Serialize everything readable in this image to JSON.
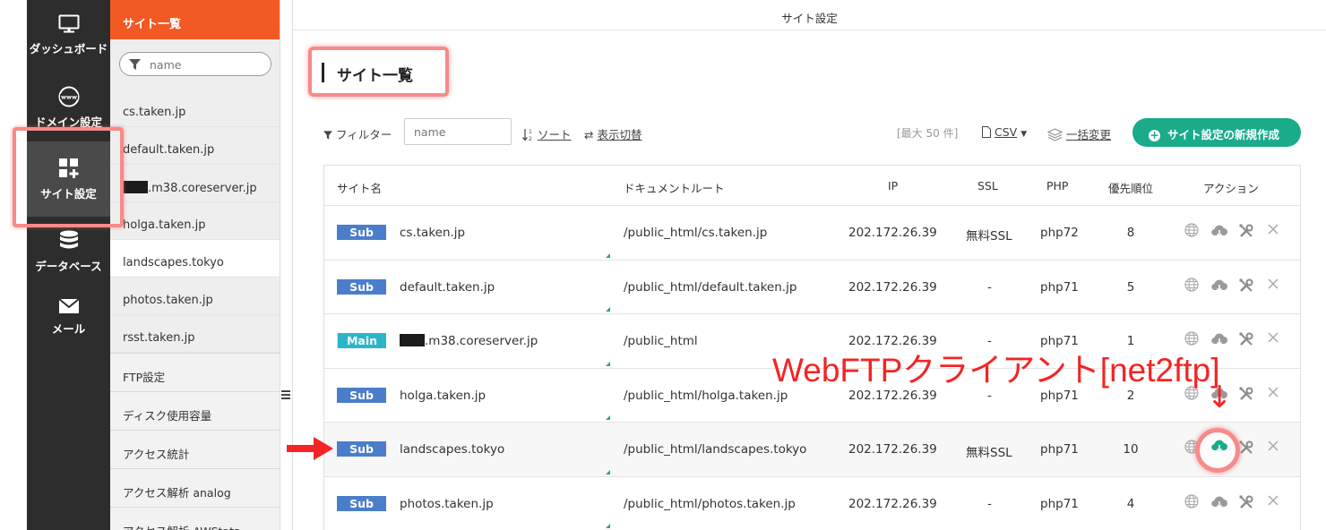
{
  "nav": {
    "items": [
      {
        "label": "ダッシュボード",
        "icon": "monitor-icon"
      },
      {
        "label": "ドメイン設定",
        "icon": "www-globe-icon"
      },
      {
        "label": "サイト設定",
        "icon": "grid-plus-icon",
        "active": true
      },
      {
        "label": "データベース",
        "icon": "database-icon"
      },
      {
        "label": "メール",
        "icon": "mail-icon"
      }
    ]
  },
  "sidebar": {
    "header": "サイト一覧",
    "search_placeholder": "name",
    "sites": [
      {
        "label": "cs.taken.jp"
      },
      {
        "label": "default.taken.jp"
      },
      {
        "label": ".m38.coreserver.jp",
        "redacted": true
      },
      {
        "label": "holga.taken.jp"
      },
      {
        "label": "landscapes.tokyo",
        "active": true
      },
      {
        "label": "photos.taken.jp"
      },
      {
        "label": "rsst.taken.jp"
      }
    ],
    "menu": [
      {
        "label": "FTP設定"
      },
      {
        "label": "ディスク使用容量"
      },
      {
        "label": "アクセス統計"
      },
      {
        "label": "アクセス解析 analog"
      },
      {
        "label": "アクセス解析 AWStats"
      }
    ]
  },
  "main": {
    "topbar_title": "サイト設定",
    "page_title": "サイト一覧",
    "toolbar": {
      "filter_label": "フィルター",
      "filter_placeholder": "name",
      "sort_label": "ソート",
      "view_toggle_label": "表示切替",
      "max_count": "[最大 50 件]",
      "csv_label": "CSV",
      "bulk_change_label": "一括変更",
      "new_button_label": "サイト設定の新規作成"
    },
    "table": {
      "headers": {
        "name": "サイト名",
        "doc_root": "ドキュメントルート",
        "ip": "IP",
        "ssl": "SSL",
        "php": "PHP",
        "priority": "優先順位",
        "action": "アクション"
      },
      "rows": [
        {
          "badge": "Sub",
          "name": "cs.taken.jp",
          "doc_root": "/public_html/cs.taken.jp",
          "ip": "202.172.26.39",
          "ssl": "無料SSL",
          "php": "php72",
          "priority": "8"
        },
        {
          "badge": "Sub",
          "name": "default.taken.jp",
          "doc_root": "/public_html/default.taken.jp",
          "ip": "202.172.26.39",
          "ssl": "-",
          "php": "php71",
          "priority": "5"
        },
        {
          "badge": "Main",
          "name": ".m38.coreserver.jp",
          "redacted": true,
          "doc_root": "/public_html",
          "ip": "202.172.26.39",
          "ssl": "-",
          "php": "php71",
          "priority": "1"
        },
        {
          "badge": "Sub",
          "name": "holga.taken.jp",
          "doc_root": "/public_html/holga.taken.jp",
          "ip": "202.172.26.39",
          "ssl": "-",
          "php": "php71",
          "priority": "2"
        },
        {
          "badge": "Sub",
          "name": "landscapes.tokyo",
          "doc_root": "/public_html/landscapes.tokyo",
          "ip": "202.172.26.39",
          "ssl": "無料SSL",
          "php": "php71",
          "priority": "10",
          "highlight": true
        },
        {
          "badge": "Sub",
          "name": "photos.taken.jp",
          "doc_root": "/public_html/photos.taken.jp",
          "ip": "202.172.26.39",
          "ssl": "-",
          "php": "php71",
          "priority": "4"
        }
      ],
      "action_icons": [
        "globe-icon",
        "cloud-ftp-icon",
        "tools-icon",
        "close-icon"
      ]
    }
  },
  "annotation": {
    "label": "WebFTPクライアント[net2ftp]",
    "down_arrow": "↓",
    "color": "#f42424"
  },
  "colors": {
    "accent": "#f15a24",
    "primary": "#1aab8a",
    "sub_badge": "#4a7ecb",
    "main_badge": "#2bb5c8",
    "nav_bg": "#2d2d2d"
  }
}
